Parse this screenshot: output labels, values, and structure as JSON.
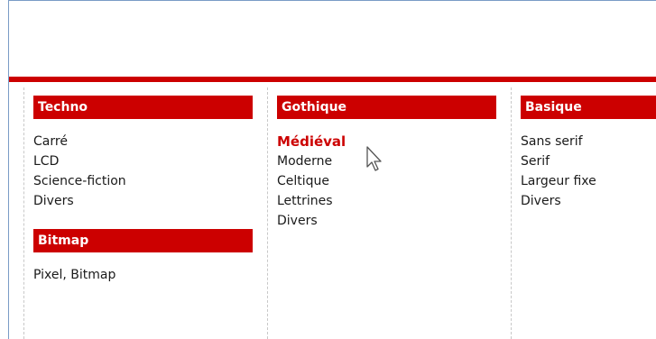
{
  "columns": [
    {
      "header": "Techno",
      "items": [
        "Carré",
        "LCD",
        "Science-fiction",
        "Divers"
      ],
      "sub": {
        "header": "Bitmap",
        "items": [
          "Pixel, Bitmap"
        ]
      }
    },
    {
      "header": "Gothique",
      "items": [
        "Médiéval",
        "Moderne",
        "Celtique",
        "Lettrines",
        "Divers"
      ],
      "active_item": "Médiéval"
    },
    {
      "header": "Basique",
      "items": [
        "Sans serif",
        "Serif",
        "Largeur fixe",
        "Divers"
      ]
    }
  ],
  "colors": {
    "accent": "#cc0000",
    "frame_border": "#7a9cc6",
    "divider": "#c8c8c8"
  },
  "icons": {
    "cursor": "mouse-pointer-icon"
  }
}
